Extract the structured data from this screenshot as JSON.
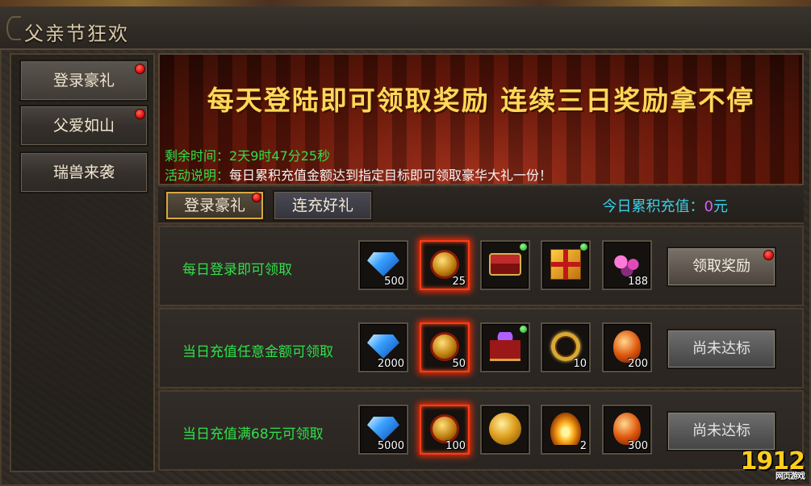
{
  "window": {
    "title": "父亲节狂欢"
  },
  "sidebar": {
    "items": [
      {
        "label": "登录豪礼",
        "badge": true
      },
      {
        "label": "父爱如山",
        "badge": true
      },
      {
        "label": "瑞兽来袭",
        "badge": false
      }
    ]
  },
  "banner": {
    "headline": "每天登陆即可领取奖励 连续三日奖励拿不停",
    "remaining_label": "剩余时间：",
    "remaining_value": "2天9时47分25秒",
    "desc_label": "活动说明：",
    "desc_value": "每日累积充值金额达到指定目标即可领取豪华大礼一份！"
  },
  "tabs": [
    {
      "label": "登录豪礼",
      "active": true,
      "badge": true
    },
    {
      "label": "连充好礼",
      "active": false,
      "badge": false
    }
  ],
  "recharge": {
    "label": "今日累积充值：",
    "amount": "0",
    "unit": "元"
  },
  "rows": [
    {
      "label": "每日登录即可领取",
      "button": "领取奖励",
      "button_state": "claim",
      "items": [
        {
          "icon": "diamond-icon",
          "qty": "500"
        },
        {
          "icon": "gold-coin-icon",
          "qty": "25",
          "glow": true
        },
        {
          "icon": "treasure-chest-icon",
          "qty": "",
          "new": true
        },
        {
          "icon": "gift-box-icon",
          "qty": "",
          "new": true
        },
        {
          "icon": "flower-icon",
          "qty": "188"
        }
      ]
    },
    {
      "label": "当日充值任意金额可领取",
      "button": "尚未达标",
      "button_state": "disabled",
      "items": [
        {
          "icon": "diamond-icon",
          "qty": "2000"
        },
        {
          "icon": "gold-coin-icon",
          "qty": "50",
          "glow": true
        },
        {
          "icon": "mystery-box-icon",
          "qty": "",
          "new": true
        },
        {
          "icon": "golden-ring-icon",
          "qty": "10"
        },
        {
          "icon": "fire-egg-icon",
          "qty": "200"
        }
      ]
    },
    {
      "label": "当日充值满68元可领取",
      "button": "尚未达标",
      "button_state": "disabled",
      "items": [
        {
          "icon": "diamond-icon",
          "qty": "5000"
        },
        {
          "icon": "gold-coin-icon",
          "qty": "100",
          "glow": true
        },
        {
          "icon": "golden-orb-icon",
          "qty": ""
        },
        {
          "icon": "golden-flame-icon",
          "qty": "2"
        },
        {
          "icon": "fire-egg-icon",
          "qty": "300"
        }
      ]
    }
  ],
  "watermark": {
    "brand": "1912",
    "tag": "网页游戏"
  }
}
